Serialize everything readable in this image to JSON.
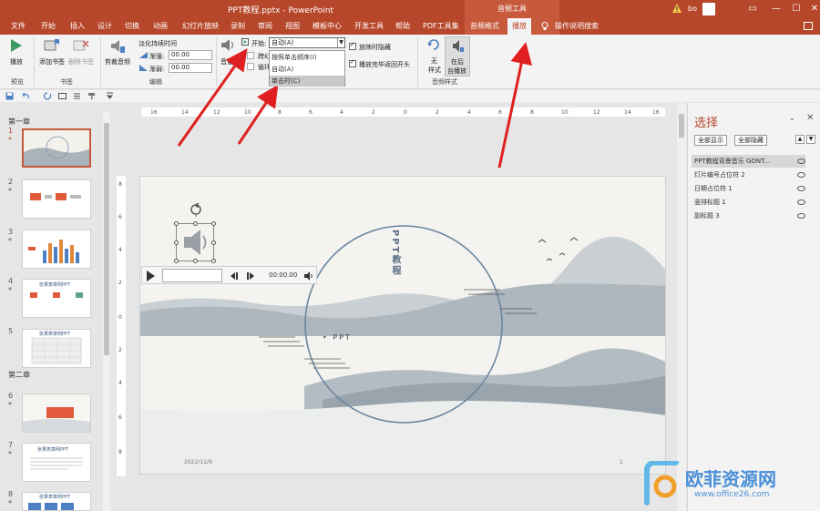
{
  "titlebar": {
    "title": "PPT教程.pptx  -  PowerPoint",
    "context_group": "音频工具",
    "user": "bo",
    "minimize": "—",
    "restore": "☐",
    "close": "✕"
  },
  "tabs": {
    "file": "文件",
    "home": "开始",
    "insert": "插入",
    "design": "设计",
    "transitions": "切换",
    "animations": "动画",
    "slideshow": "幻灯片放映",
    "record": "录制",
    "review": "审阅",
    "view": "视图",
    "template": "模板中心",
    "developer": "开发工具",
    "help": "帮助",
    "pdf": "PDF工具集",
    "audio_format": "音频格式",
    "playback": "播放",
    "tell_me": "操作说明搜索"
  },
  "ribbon": {
    "play_label": "播放",
    "preview_group": "预览",
    "add_bookmark": "添加书签",
    "remove_bookmark": "删除书签",
    "bookmark_group": "书签",
    "trim_audio": "剪裁音频",
    "fade_duration": "淡化持续时间",
    "fade_in": "渐强:",
    "fade_out": "渐弱:",
    "fade_in_value": "00.00",
    "fade_out_value": "00.00",
    "editing_group": "编辑",
    "volume": "音量",
    "start_label": "开始:",
    "start_value": "自动(A)",
    "cross_slides": "跨幻灯片",
    "loop": "循环播放",
    "hide_during_show": "放映时隐藏",
    "rewind_after": "播放完毕返回开头",
    "no_style": "无",
    "style": "样式",
    "play_in_background": "在后",
    "play_in_background_2": "台播放",
    "audio_styles_group": "音频样式"
  },
  "dropdown": {
    "items": [
      "按照单击顺序(I)",
      "自动(A)",
      "单击时(C)"
    ],
    "highlighted_index": 2
  },
  "thumbnails": {
    "section_1": "第一章",
    "section_2": "第二章",
    "slide_numbers": [
      "1",
      "2",
      "3",
      "4",
      "5",
      "6",
      "7",
      "8"
    ],
    "star": "*",
    "thumb_titles": [
      "",
      "",
      "",
      "张果表章例PPT",
      "张果表章例PPT",
      "",
      "张果表章例PPT",
      "张果表章例PPT"
    ]
  },
  "ruler": {
    "h": [
      "16",
      "14",
      "12",
      "10",
      "8",
      "6",
      "4",
      "2",
      "0",
      "2",
      "4",
      "6",
      "8",
      "10",
      "12",
      "14",
      "16"
    ],
    "v": [
      "8",
      "6",
      "4",
      "2",
      "0",
      "2",
      "4",
      "6",
      "8"
    ]
  },
  "slide": {
    "vertical_title": "PPT教程",
    "subtitle": "PPT",
    "date": "2022/11/9",
    "page_no": "1",
    "media_time": "00:00.00"
  },
  "selection_pane": {
    "title": "选择",
    "show_all": "全部显示",
    "hide_all": "全部隐藏",
    "items": [
      "PPT教程背景音乐 GONT...",
      "灯片编号占位符 2",
      "日期占位符 1",
      "竖排标题 1",
      "副标题 3"
    ]
  },
  "watermark": {
    "text": "欧菲资源网",
    "url": "www.office26.com"
  },
  "colors": {
    "brand": "#b7472a",
    "annotation": "#e02020"
  }
}
